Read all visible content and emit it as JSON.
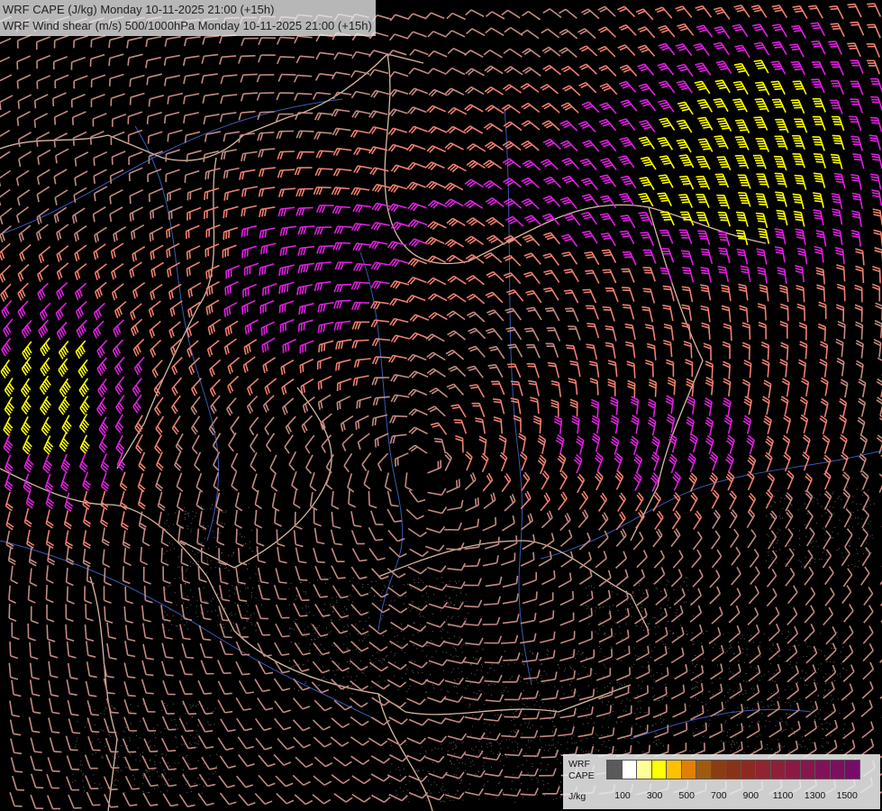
{
  "title": {
    "line1": "WRF CAPE (J/kg) Monday 10-11-2025 21:00 (+15h)",
    "line2": "WRF Wind shear (m/s) 500/1000hPa Monday 10-11-2025 21:00 (+15h)"
  },
  "legend": {
    "label_line1": "WRF",
    "label_line2": "CAPE",
    "label_line3": "J/kg",
    "swatch_colors": [
      "#5a5a5a",
      "#ffffff",
      "#ffff99",
      "#ffff00",
      "#ffc000",
      "#e08000",
      "#a05a10",
      "#8a3c14",
      "#8a3218",
      "#8c2a22",
      "#902430",
      "#8e1f3a",
      "#8a1a44",
      "#86164c",
      "#821256",
      "#7e0e60",
      "#780a6a"
    ],
    "ticks": [
      "100",
      "300",
      "500",
      "700",
      "900",
      "1100",
      "1300",
      "1500"
    ]
  },
  "colors": {
    "background": "#000000",
    "country_border": "#d8b9a0",
    "river": "#3a5ab4",
    "shear_low": "#c58a82",
    "shear_mid": "#f08070",
    "shear_high": "#e020e0",
    "shear_max": "#ffff00"
  },
  "icons": {
    "barb": "wind-barb-icon"
  }
}
